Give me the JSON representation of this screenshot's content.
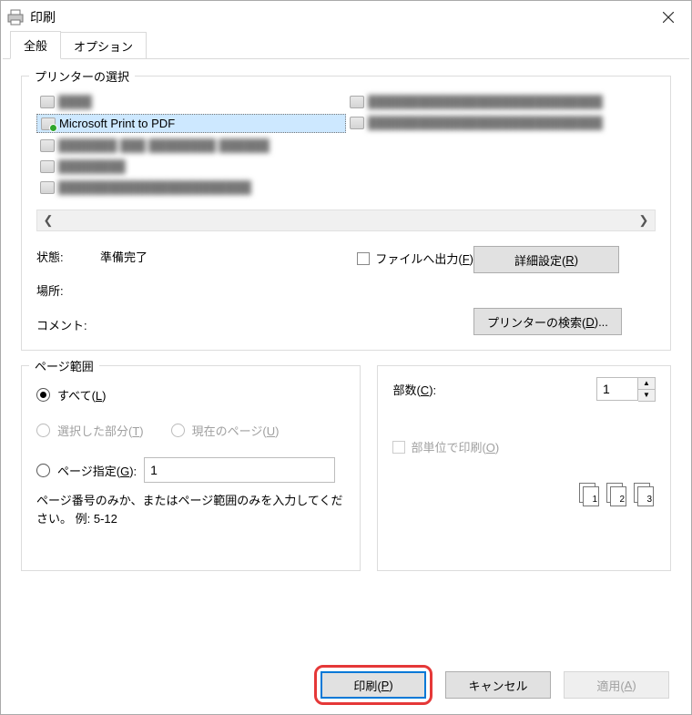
{
  "title": "印刷",
  "tabs": {
    "general": "全般",
    "options": "オプション"
  },
  "printerGroup": {
    "legend": "プリンターの選択",
    "items": {
      "selected": "Microsoft Print to PDF"
    },
    "status": {
      "label": "状態:",
      "value": "準備完了"
    },
    "location": {
      "label": "場所:"
    },
    "comment": {
      "label": "コメント:"
    },
    "outputToFile": {
      "label": "ファイルへ出力(",
      "key": "F",
      "tail": ")"
    },
    "details": {
      "label": "詳細設定(",
      "key": "R",
      "tail": ")"
    },
    "findPrinter": {
      "label": "プリンターの検索(",
      "key": "D",
      "tail": ")..."
    }
  },
  "pageRange": {
    "legend": "ページ範囲",
    "all": {
      "label": "すべて(",
      "key": "L",
      "tail": ")"
    },
    "selection": {
      "label": "選択した部分(",
      "key": "T",
      "tail": ")"
    },
    "currentPage": {
      "label": "現在のページ(",
      "key": "U",
      "tail": ")"
    },
    "pages": {
      "label": "ページ指定(",
      "key": "G",
      "tail": "):"
    },
    "pagesValue": "1",
    "hint": "ページ番号のみか、またはページ範囲のみを入力してください。 例: 5-12"
  },
  "copies": {
    "label": "部数(",
    "key": "C",
    "tail": "):",
    "value": "1",
    "collate": {
      "label": "部単位で印刷(",
      "key": "O",
      "tail": ")"
    },
    "stackNums": [
      "1",
      "2",
      "3"
    ]
  },
  "footer": {
    "print": {
      "label": "印刷(",
      "key": "P",
      "tail": ")"
    },
    "cancel": "キャンセル",
    "apply": {
      "label": "適用(",
      "key": "A",
      "tail": ")"
    }
  }
}
